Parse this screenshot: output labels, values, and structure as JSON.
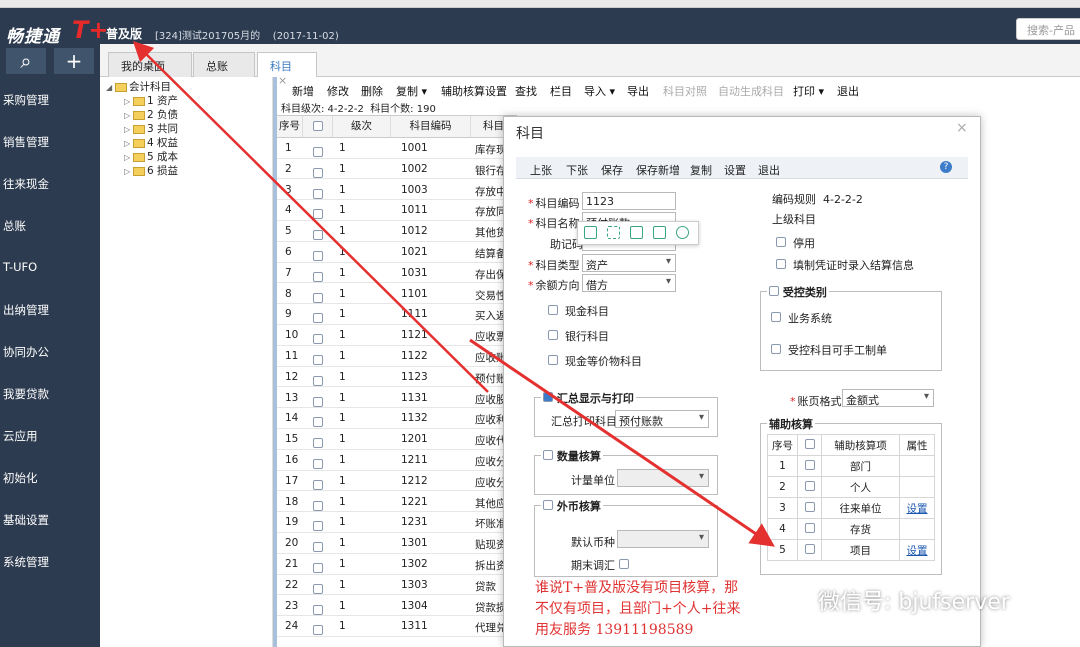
{
  "app": {
    "logo_text": "畅捷通",
    "logo_mark": "T+",
    "edition": "普及版",
    "account": "[324]测试201705月的",
    "date": "(2017-11-02)",
    "search_placeholder": "搜索-产品"
  },
  "sidebar": {
    "items": [
      "采购管理",
      "销售管理",
      "往来现金",
      "总账",
      "T-UFO",
      "出纳管理",
      "协同办公",
      "我要贷款",
      "云应用",
      "初始化",
      "基础设置",
      "系统管理"
    ]
  },
  "tabs": [
    {
      "label": "我的桌面"
    },
    {
      "label": "总账"
    },
    {
      "label": "科目"
    }
  ],
  "tree": {
    "root": "会计科目",
    "children": [
      "1 资产",
      "2 负债",
      "3 共同",
      "4 权益",
      "5 成本",
      "6 损益"
    ]
  },
  "toolbar": [
    "新增",
    "修改",
    "删除",
    "复制 ▾",
    "辅助核算设置",
    "查找",
    "栏目",
    "导入 ▾",
    "导出",
    "科目对照",
    "自动生成科目",
    "打印 ▾",
    "退出"
  ],
  "info": {
    "levels": "科目级次: 4-2-2-2",
    "count": "科目个数: 190"
  },
  "grid": {
    "headers": [
      "序号",
      "",
      "级次",
      "科目编码",
      "科目"
    ],
    "rows": [
      {
        "no": "1",
        "level": "1",
        "code": "1001",
        "name": "库存现"
      },
      {
        "no": "2",
        "level": "1",
        "code": "1002",
        "name": "银行存"
      },
      {
        "no": "3",
        "level": "1",
        "code": "1003",
        "name": "存放中"
      },
      {
        "no": "4",
        "level": "1",
        "code": "1011",
        "name": "存放同"
      },
      {
        "no": "5",
        "level": "1",
        "code": "1012",
        "name": "其他货"
      },
      {
        "no": "6",
        "level": "1",
        "code": "1021",
        "name": "结算备"
      },
      {
        "no": "7",
        "level": "1",
        "code": "1031",
        "name": "存出保"
      },
      {
        "no": "8",
        "level": "1",
        "code": "1101",
        "name": "交易性"
      },
      {
        "no": "9",
        "level": "1",
        "code": "1111",
        "name": "买入返"
      },
      {
        "no": "10",
        "level": "1",
        "code": "1121",
        "name": "应收票"
      },
      {
        "no": "11",
        "level": "1",
        "code": "1122",
        "name": "应收账"
      },
      {
        "no": "12",
        "level": "1",
        "code": "1123",
        "name": "预付账"
      },
      {
        "no": "13",
        "level": "1",
        "code": "1131",
        "name": "应收股"
      },
      {
        "no": "14",
        "level": "1",
        "code": "1132",
        "name": "应收利"
      },
      {
        "no": "15",
        "level": "1",
        "code": "1201",
        "name": "应收代"
      },
      {
        "no": "16",
        "level": "1",
        "code": "1211",
        "name": "应收分"
      },
      {
        "no": "17",
        "level": "1",
        "code": "1212",
        "name": "应收分"
      },
      {
        "no": "18",
        "level": "1",
        "code": "1221",
        "name": "其他应"
      },
      {
        "no": "19",
        "level": "1",
        "code": "1231",
        "name": "坏账准"
      },
      {
        "no": "20",
        "level": "1",
        "code": "1301",
        "name": "贴现资"
      },
      {
        "no": "21",
        "level": "1",
        "code": "1302",
        "name": "拆出资"
      },
      {
        "no": "22",
        "level": "1",
        "code": "1303",
        "name": "贷款"
      },
      {
        "no": "23",
        "level": "1",
        "code": "1304",
        "name": "贷款损"
      },
      {
        "no": "24",
        "level": "1",
        "code": "1311",
        "name": "代理兑"
      }
    ]
  },
  "dialog": {
    "title": "科目",
    "toolbar": [
      "上张",
      "下张",
      "保存",
      "保存新增",
      "复制",
      "设置",
      "退出"
    ],
    "code_label": "科目编码",
    "code_value": "1123",
    "name_label": "科目名称",
    "name_value": "预付账款",
    "mnemonic_label": "助记码",
    "type_label": "科目类型",
    "type_value": "资产",
    "balance_label": "余额方向",
    "balance_value": "借方",
    "code_rule_label": "编码规则",
    "code_rule_value": "4-2-2-2",
    "parent_label": "上级科目",
    "disable_label": "停用",
    "settle_label": "填制凭证时录入结算信息",
    "cash_label": "现金科目",
    "bank_label": "银行科目",
    "cash_equiv_label": "现金等价物科目",
    "control_title": "受控类别",
    "biz_label": "业务系统",
    "manual_label": "受控科目可手工制单",
    "summary_title": "汇总显示与打印",
    "summary_print_label": "汇总打印科目",
    "summary_print_value": "预付账款",
    "ledger_label": "账页格式",
    "ledger_value": "金额式",
    "qty_title": "数量核算",
    "unit_label": "计量单位",
    "fx_title": "外币核算",
    "currency_label": "默认币种",
    "fx_adjust_label": "期末调汇",
    "aux_title": "辅助核算",
    "aux_headers": [
      "序号",
      "",
      "辅助核算项",
      "属性"
    ],
    "aux_rows": [
      {
        "no": "1",
        "item": "部门",
        "attr": ""
      },
      {
        "no": "2",
        "item": "个人",
        "attr": ""
      },
      {
        "no": "3",
        "item": "往来单位",
        "attr": "设置"
      },
      {
        "no": "4",
        "item": "存货",
        "attr": ""
      },
      {
        "no": "5",
        "item": "项目",
        "attr": "设置"
      }
    ]
  },
  "annotation": {
    "line1": "谁说T+普及版没有项目核算，那",
    "line2": "不仅有项目，且部门+个人+往来",
    "line3": "用友服务 13911198589"
  },
  "watermark": "微信号: bjufserver",
  "colors": {
    "topbar": "#2c3b4f",
    "accent": "#3a7bbf",
    "annotation": "#e03434"
  }
}
